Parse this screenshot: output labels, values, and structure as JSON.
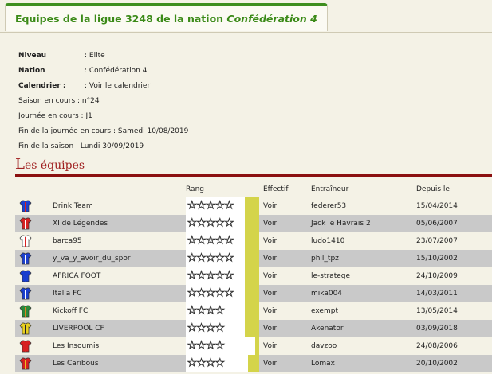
{
  "header": {
    "title_prefix": "Equipes de la ligue 3248 de la nation ",
    "title_nation": "Confédération 4"
  },
  "info": {
    "niveau_label": "Niveau",
    "niveau_value": ": Elite",
    "nation_label": "Nation",
    "nation_value": ": Confédération 4",
    "calendrier_label": "Calendrier :",
    "calendrier_value": ": Voir le calendrier",
    "saison": "Saison en cours : n°24",
    "journee": "Journée en cours : J1",
    "fin_journee": "Fin de la journée en cours : Samedi 10/08/2019",
    "fin_saison": "Fin de la saison : Lundi 30/09/2019"
  },
  "section": {
    "title_first": "L",
    "title_rest": "es équipes"
  },
  "table": {
    "headers": {
      "rang": "Rang",
      "effectif": "Effectif",
      "entraineur": "Entraîneur",
      "depuis": "Depuis le"
    },
    "rows": [
      {
        "team": "Drink Team",
        "effectif": "Voir",
        "coach": "federer53",
        "since": "15/04/2014",
        "stars": "★★★★★",
        "level": 0.2,
        "jersey": "blue-red",
        "colors": [
          "#1a3fd0",
          "#d82020"
        ]
      },
      {
        "team": "XI de Légendes",
        "effectif": "Voir",
        "coach": "Jack le Havrais 2",
        "since": "05/06/2007",
        "stars": "★★★★★",
        "level": 0.2,
        "jersey": "red-white",
        "colors": [
          "#d82020",
          "#ffffff"
        ]
      },
      {
        "team": "barca95",
        "effectif": "Voir",
        "coach": "ludo1410",
        "since": "23/07/2007",
        "stars": "★★★★★",
        "level": 0.2,
        "jersey": "white-red",
        "colors": [
          "#ffffff",
          "#d82020"
        ]
      },
      {
        "team": "y_va_y_avoir_du_spor",
        "effectif": "Voir",
        "coach": "phil_tpz",
        "since": "15/10/2002",
        "stars": "★★★★★",
        "level": 0.2,
        "jersey": "blue-stripes",
        "colors": [
          "#1a3fd0",
          "#ffffff"
        ]
      },
      {
        "team": "AFRICA FOOT",
        "effectif": "Voir",
        "coach": "le-stratege",
        "since": "24/10/2009",
        "stars": "★★★★★",
        "level": 0.2,
        "jersey": "blue",
        "colors": [
          "#1a3fd0",
          "#1a3fd0"
        ]
      },
      {
        "team": "Italia FC",
        "effectif": "Voir",
        "coach": "mika004",
        "since": "14/03/2011",
        "stars": "★★★★★",
        "level": 0.2,
        "jersey": "blue-white",
        "colors": [
          "#1a3fd0",
          "#ffffff"
        ]
      },
      {
        "team": "Kickoff FC",
        "effectif": "Voir",
        "coach": "exempt",
        "since": "13/05/2014",
        "stars": "★★★★",
        "level": 0.2,
        "jersey": "green-orange",
        "colors": [
          "#2a8a3a",
          "#e08020"
        ]
      },
      {
        "team": "LIVERPOOL CF",
        "effectif": "Voir",
        "coach": "Akenator",
        "since": "03/09/2018",
        "stars": "★★★★",
        "level": 0.2,
        "jersey": "yellow-black",
        "colors": [
          "#e8d020",
          "#222222"
        ]
      },
      {
        "team": "Les Insoumis",
        "effectif": "Voir",
        "coach": "davzoo",
        "since": "24/08/2006",
        "stars": "★★★★",
        "level": 0.05,
        "jersey": "red",
        "colors": [
          "#d82020",
          "#d82020"
        ]
      },
      {
        "team": "Les Caribous",
        "effectif": "Voir",
        "coach": "Lomax",
        "since": "20/10/2002",
        "stars": "★★★★",
        "level": 0.15,
        "jersey": "red-yellow",
        "colors": [
          "#d82020",
          "#e8c020"
        ]
      }
    ]
  }
}
